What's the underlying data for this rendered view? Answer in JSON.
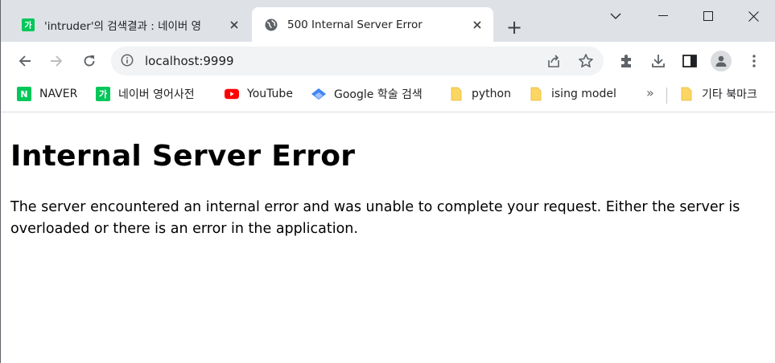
{
  "tabs": [
    {
      "title": "'intruder'의 검색결과 : 네이버 영",
      "favicon": "naver-ga-icon",
      "active": false
    },
    {
      "title": "500 Internal Server Error",
      "favicon": "globe-icon",
      "active": true
    }
  ],
  "favicon_letters": {
    "naver_ga": "가",
    "naver_n": "N"
  },
  "new_tab_label": "+",
  "window_controls": [
    "chevron-down-icon",
    "minimize-icon",
    "maximize-icon",
    "close-icon"
  ],
  "address_bar": {
    "url": "localhost:9999"
  },
  "bookmarks": [
    {
      "label": "NAVER",
      "icon": "naver-n-icon"
    },
    {
      "label": "네이버 영어사전",
      "icon": "naver-ga-icon"
    },
    {
      "label": "YouTube",
      "icon": "youtube-icon"
    },
    {
      "label": "Google 학술 검색",
      "icon": "scholar-icon"
    },
    {
      "label": "python",
      "icon": "folder-icon"
    },
    {
      "label": "ising model",
      "icon": "folder-icon"
    }
  ],
  "bookmarks_overflow": "»",
  "other_bookmarks": {
    "label": "기타 북마크",
    "icon": "folder-icon"
  },
  "page": {
    "heading": "Internal Server Error",
    "message": "The server encountered an internal error and was unable to complete your request. Either the server is overloaded or there is an error in the application."
  },
  "colors": {
    "naver_green": "#03c75a",
    "youtube_red": "#ff0000",
    "folder_yellow": "#fcd663",
    "scholar_blue": "#4285f4"
  }
}
